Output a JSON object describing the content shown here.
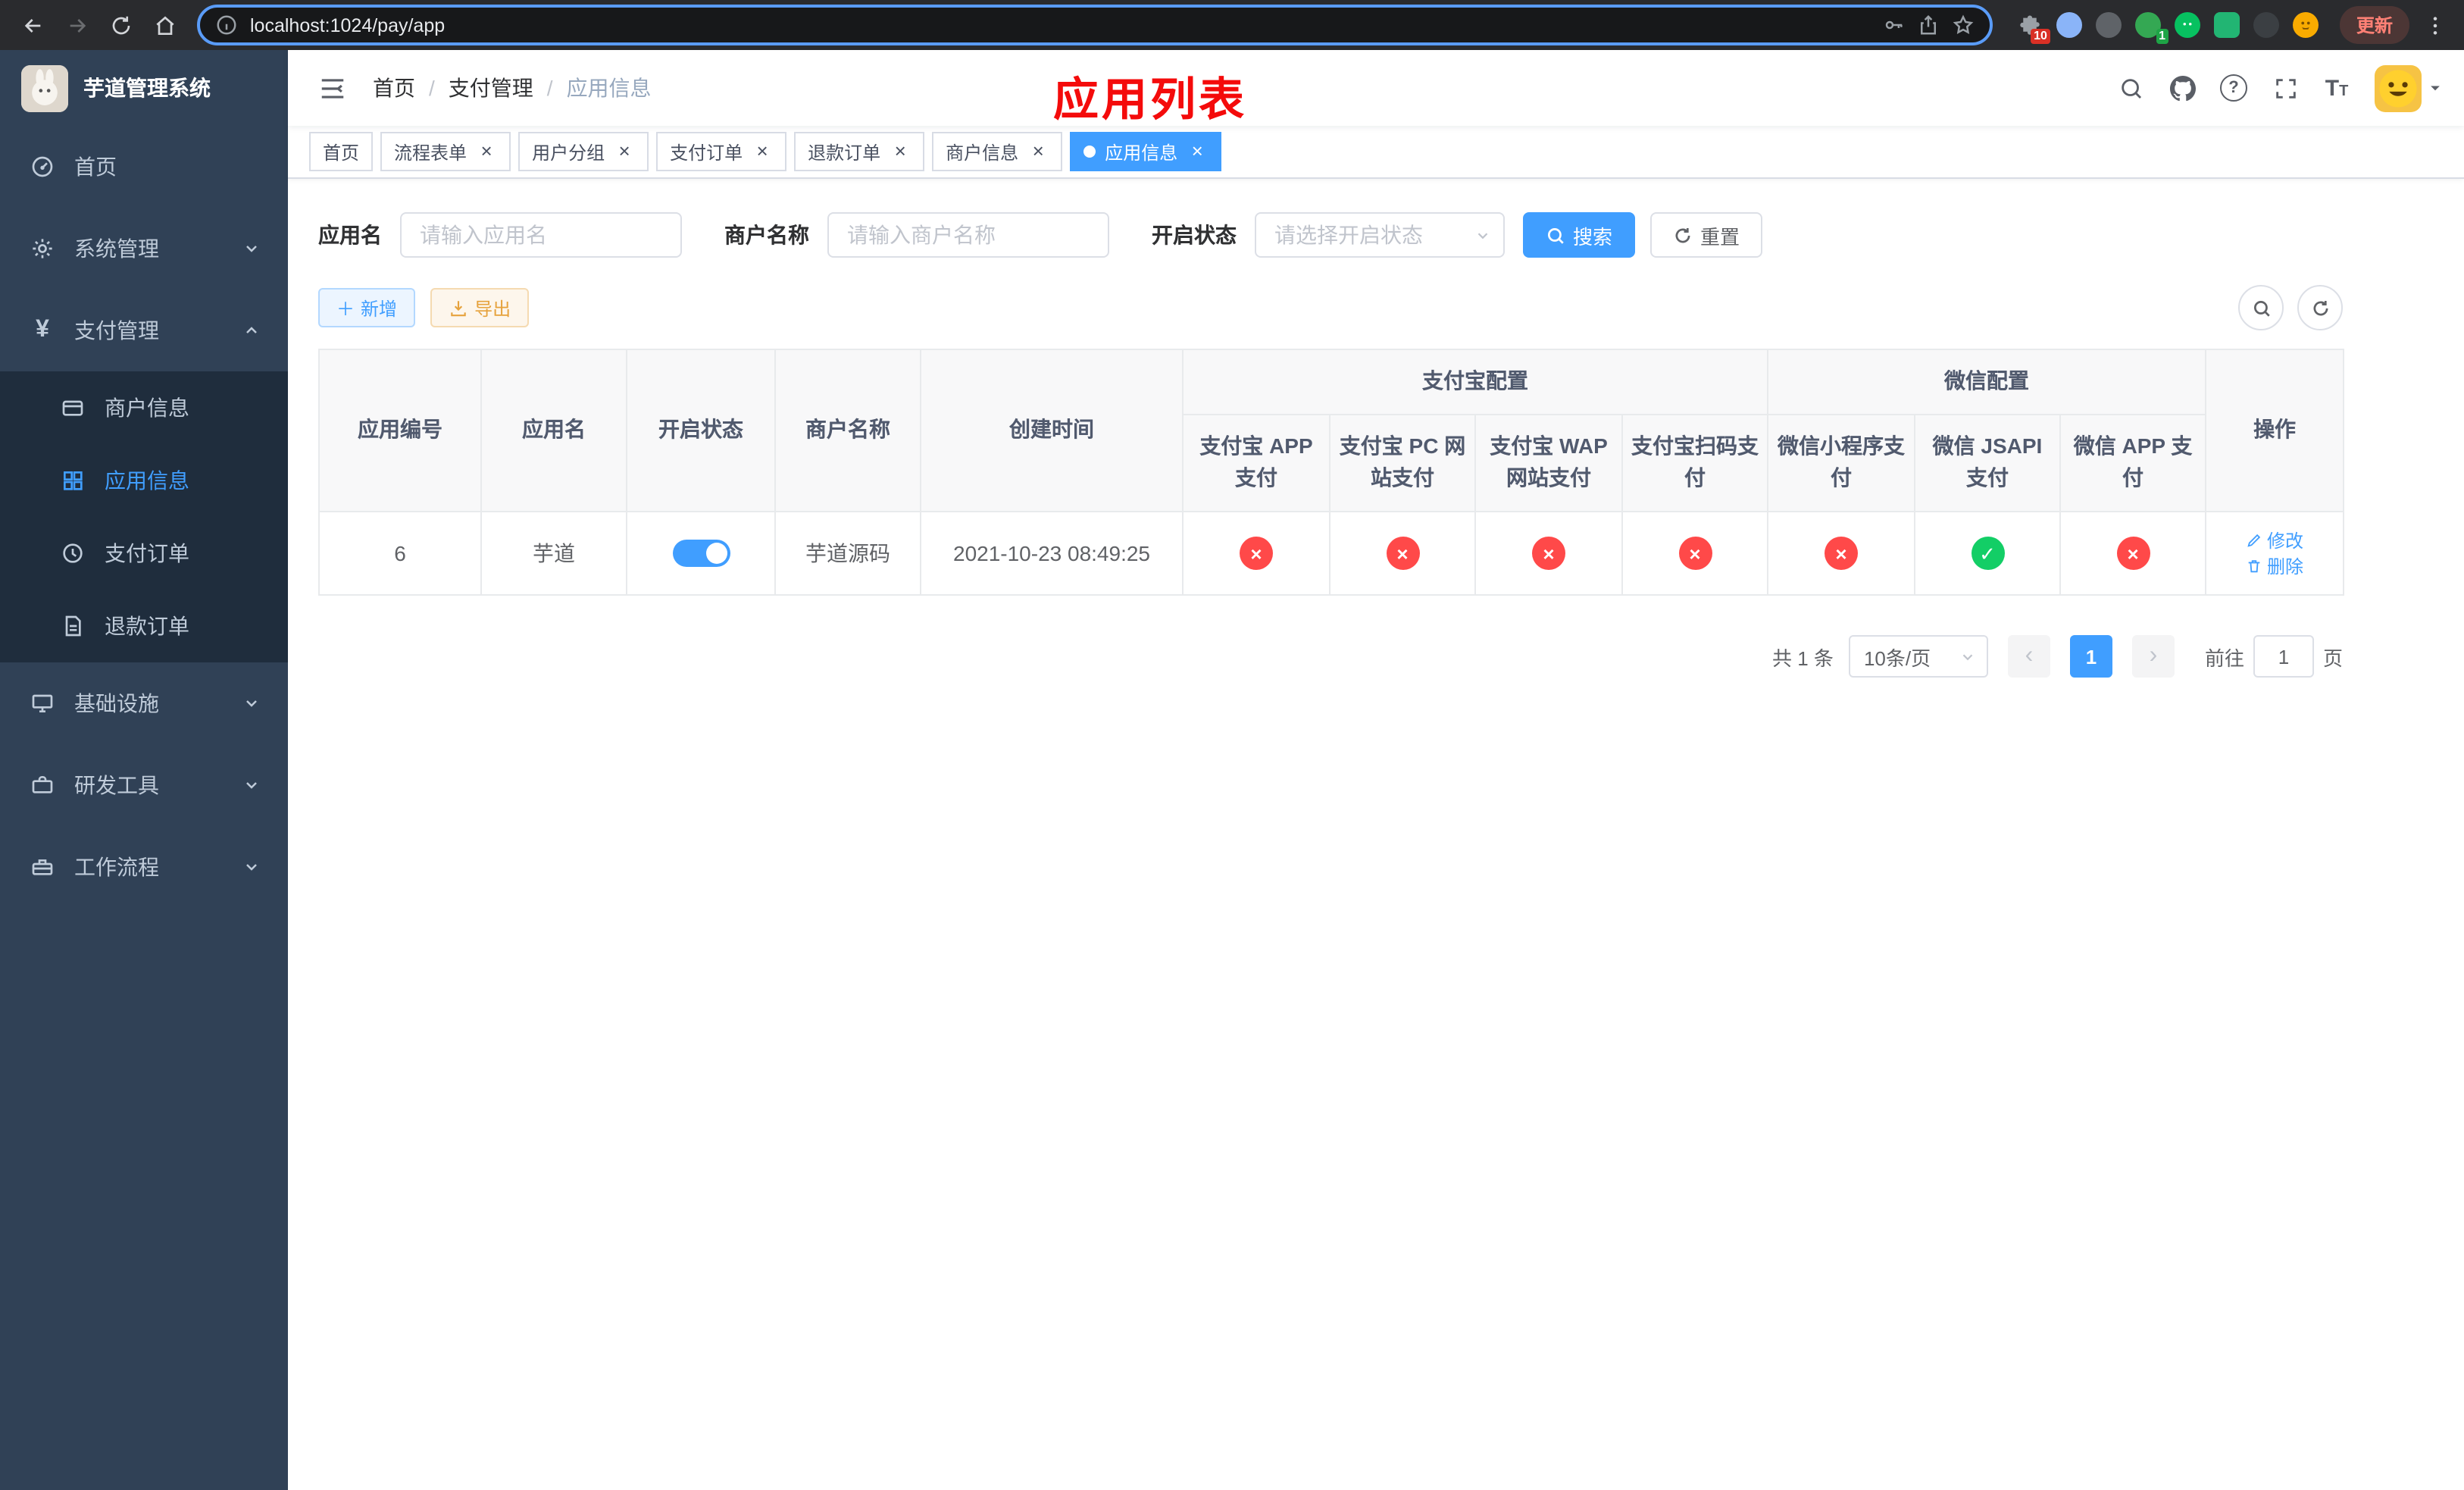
{
  "browser": {
    "url": "localhost:1024/pay/app",
    "update_label": "更新",
    "extension_badge_count": "10",
    "green_badge_count": "1"
  },
  "sidebar": {
    "title": "芋道管理系统",
    "items": {
      "home": "首页",
      "system": "系统管理",
      "payment": "支付管理",
      "merchant": "商户信息",
      "app": "应用信息",
      "pay_order": "支付订单",
      "refund_order": "退款订单",
      "infra": "基础设施",
      "devtools": "研发工具",
      "workflow": "工作流程"
    }
  },
  "header": {
    "breadcrumb": [
      "首页",
      "支付管理",
      "应用信息"
    ],
    "annotation": "应用列表"
  },
  "tabs": [
    {
      "label": "首页"
    },
    {
      "label": "流程表单"
    },
    {
      "label": "用户分组"
    },
    {
      "label": "支付订单"
    },
    {
      "label": "退款订单"
    },
    {
      "label": "商户信息"
    },
    {
      "label": "应用信息"
    }
  ],
  "filters": {
    "app_name_label": "应用名",
    "app_name_placeholder": "请输入应用名",
    "merchant_label": "商户名称",
    "merchant_placeholder": "请输入商户名称",
    "status_label": "开启状态",
    "status_placeholder": "请选择开启状态",
    "search_label": "搜索",
    "reset_label": "重置"
  },
  "toolbar": {
    "add_label": "新增",
    "export_label": "导出"
  },
  "table": {
    "groups": {
      "alipay": "支付宝配置",
      "wechat": "微信配置"
    },
    "columns": [
      "应用编号",
      "应用名",
      "开启状态",
      "商户名称",
      "创建时间",
      "支付宝 APP 支付",
      "支付宝 PC 网站支付",
      "支付宝 WAP 网站支付",
      "支付宝扫码支付",
      "微信小程序支付",
      "微信 JSAPI 支付",
      "微信 APP 支付",
      "操作"
    ],
    "rows": [
      {
        "id": "6",
        "name": "芋道",
        "enabled": true,
        "merchant": "芋道源码",
        "created_at": "2021-10-23 08:49:25",
        "statuses": [
          false,
          false,
          false,
          false,
          false,
          true,
          false
        ],
        "edit_label": "修改",
        "delete_label": "删除"
      }
    ]
  },
  "pagination": {
    "total": "共 1 条",
    "page_size": "10条/页",
    "current_page": "1",
    "goto_label": "前往",
    "goto_value": "1",
    "unit_label": "页"
  },
  "colors": {
    "primary": "#409eff",
    "success": "#13ce66",
    "danger": "#ff4949",
    "warning": "#e6a23c",
    "sidebar_bg": "#304156",
    "submenu_bg": "#1f2d3d",
    "annotation_red": "#f40b0b"
  }
}
